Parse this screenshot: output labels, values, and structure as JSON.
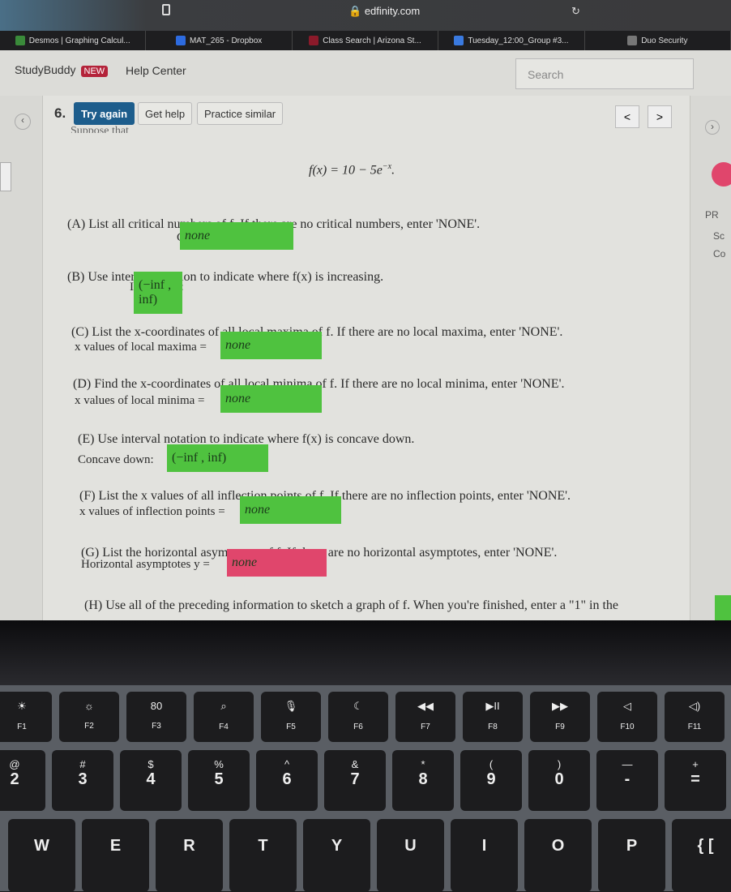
{
  "browser": {
    "url": "edfinity.com",
    "tabs": [
      {
        "label": "Desmos | Graphing Calcul...",
        "color": "#3a8a3a"
      },
      {
        "label": "MAT_265 - Dropbox",
        "color": "#2d6be0"
      },
      {
        "label": "Class Search | Arizona St...",
        "color": "#8b1a2a"
      },
      {
        "label": "Tuesday_12:00_Group #3...",
        "color": "#3a7ae0"
      },
      {
        "label": "Duo Security",
        "color": "#777"
      }
    ]
  },
  "header": {
    "studybuddy": "StudyBuddy",
    "new_badge": "NEW",
    "help_center": "Help Center",
    "search_placeholder": "Search"
  },
  "problem": {
    "number": "6.",
    "try_again": "Try again",
    "get_help": "Get help",
    "practice_similar": "Practice similar",
    "prev": "<",
    "next": ">",
    "intro": "Suppose that",
    "formula": "f(x) = 10 − 5e^{−x}.",
    "parts": [
      {
        "q": "(A) List all critical numbers of f. If there are no critical numbers, enter 'NONE'.",
        "label": "Critical numbers =",
        "answer": "none",
        "status": "correct"
      },
      {
        "q": "(B) Use interval notation to indicate where f(x) is increasing.",
        "label": "Increasing:",
        "answer": "(−inf , inf)",
        "status": "correct"
      },
      {
        "q": "(C) List the x-coordinates of all local maxima of f. If there are no local maxima, enter 'NONE'.",
        "label": "x values of local maxima =",
        "answer": "none",
        "status": "correct"
      },
      {
        "q": "(D) Find the x-coordinates of all local minima of f. If there are no local minima, enter 'NONE'.",
        "label": "x values of local minima =",
        "answer": "none",
        "status": "correct"
      },
      {
        "q": "(E) Use interval notation to indicate where f(x) is concave down.",
        "label": "Concave down:",
        "answer": "(−inf , inf)",
        "status": "correct"
      },
      {
        "q": "(F) List the x values of all inflection points of f. If there are no inflection points, enter 'NONE'.",
        "label": "x values of inflection points =",
        "answer": "none",
        "status": "correct"
      },
      {
        "q": "(G) List the horizontal asymptotes of f. If there are no horizontal asymptotes, enter 'NONE'.",
        "label": "Horizontal asymptotes y =",
        "answer": "none",
        "status": "incorrect"
      },
      {
        "q": "(H) Use all of the preceding information to sketch a graph of f. When you're finished, enter a \"1\" in the"
      }
    ]
  },
  "sidebar_right": {
    "pr": "PR",
    "sc": "Sc",
    "co": "Co"
  },
  "colors": {
    "correct": "#4fc23f",
    "incorrect": "#e0466c",
    "try_again": "#1d5d8c"
  },
  "keyboard": {
    "fn": [
      [
        "☀",
        "F1"
      ],
      [
        "☼",
        "F2"
      ],
      [
        "80",
        "F3"
      ],
      [
        "⌕",
        "F4"
      ],
      [
        "🎙",
        "F5"
      ],
      [
        "☾",
        "F6"
      ],
      [
        "◀◀",
        "F7"
      ],
      [
        "▶II",
        "F8"
      ],
      [
        "▶▶",
        "F9"
      ],
      [
        "◁",
        "F10"
      ],
      [
        "◁)",
        "F11"
      ]
    ],
    "num": [
      [
        "@",
        "2"
      ],
      [
        "#",
        "3"
      ],
      [
        "$",
        "4"
      ],
      [
        "%",
        "5"
      ],
      [
        "^",
        "6"
      ],
      [
        "&",
        "7"
      ],
      [
        "*",
        "8"
      ],
      [
        "(",
        "9"
      ],
      [
        ")",
        "0"
      ],
      [
        "—",
        "-"
      ],
      [
        "+",
        "="
      ]
    ],
    "alpha": [
      "W",
      "E",
      "R",
      "T",
      "Y",
      "U",
      "I",
      "O",
      "P",
      "{ ["
    ]
  }
}
